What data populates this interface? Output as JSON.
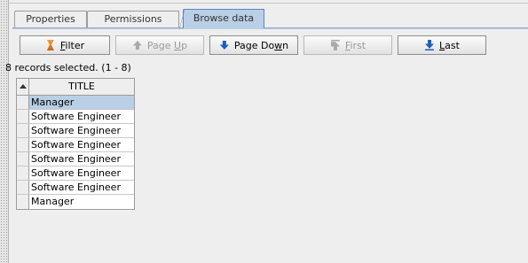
{
  "tabs": [
    {
      "label": "Properties",
      "active": false
    },
    {
      "label": "Permissions",
      "active": false
    },
    {
      "label": "Browse data",
      "active": true
    }
  ],
  "toolbar": {
    "filter": {
      "pre": "",
      "mn": "F",
      "post": "ilter",
      "icon": "filter-funnel-icon",
      "enabled": true
    },
    "page_up": {
      "pre": "Page ",
      "mn": "U",
      "post": "p",
      "icon": "arrow-up-icon",
      "enabled": false
    },
    "page_down": {
      "pre": "Page Do",
      "mn": "w",
      "post": "n",
      "icon": "arrow-down-icon",
      "enabled": true
    },
    "first": {
      "pre": "",
      "mn": "F",
      "post": "irst",
      "icon": "first-record-icon",
      "enabled": false
    },
    "last": {
      "pre": "",
      "mn": "L",
      "post": "ast",
      "icon": "last-record-icon",
      "enabled": true
    }
  },
  "status": "8  records selected. (1 - 8)",
  "table": {
    "columns": [
      "TITLE"
    ],
    "rows": [
      "Manager",
      "Software Engineer",
      "Software Engineer",
      "Software Engineer",
      "Software Engineer",
      "Software Engineer",
      "Software Engineer",
      "Manager"
    ],
    "selected_row": 0
  },
  "colors": {
    "active_tab": "#b8cfe5",
    "selection": "#b8cfe5",
    "arrow_enabled": "#1f5fb8",
    "filter_icon": "#e08a2c"
  }
}
